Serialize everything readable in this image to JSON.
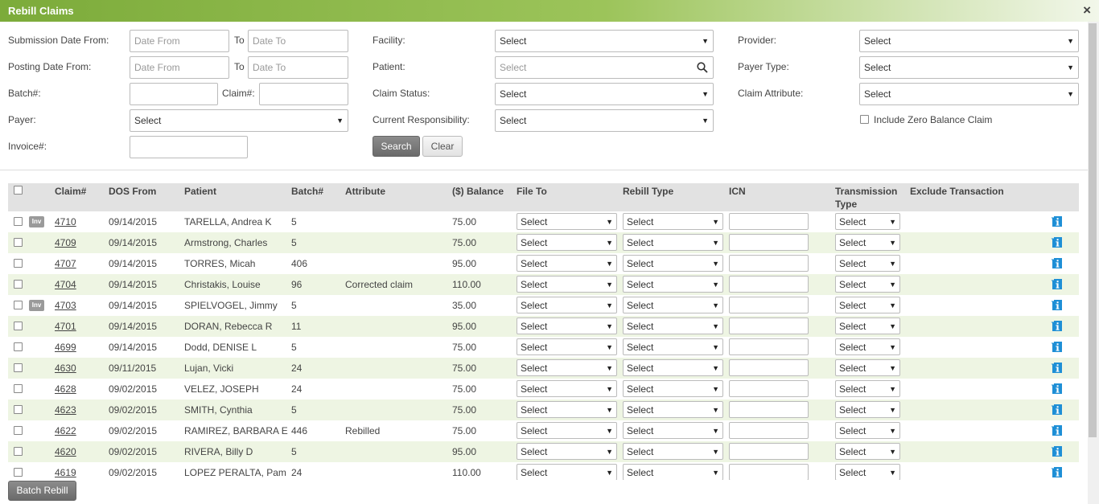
{
  "window": {
    "title": "Rebill Claims",
    "close_glyph": "×"
  },
  "filters": {
    "submission_date_label": "Submission Date From:",
    "posting_date_label": "Posting Date From:",
    "to_label": "To",
    "date_from_placeholder": "Date From",
    "date_to_placeholder": "Date To",
    "batch_label": "Batch#:",
    "claim_label": "Claim#:",
    "payer_label": "Payer:",
    "payer_value": "Select",
    "invoice_label": "Invoice#:",
    "facility_label": "Facility:",
    "facility_value": "Select",
    "patient_label": "Patient:",
    "patient_placeholder": "Select",
    "claim_status_label": "Claim Status:",
    "claim_status_value": "Select",
    "current_responsibility_label": "Current Responsibility:",
    "current_responsibility_value": "Select",
    "provider_label": "Provider:",
    "provider_value": "Select",
    "payer_type_label": "Payer Type:",
    "payer_type_value": "Select",
    "claim_attribute_label": "Claim Attribute:",
    "claim_attribute_value": "Select",
    "include_zero_balance_label": "Include Zero Balance Claim",
    "search_label": "Search",
    "clear_label": "Clear"
  },
  "grid": {
    "columns": [
      "Claim#",
      "DOS From",
      "Patient",
      "Batch#",
      "Attribute",
      "($) Balance",
      "File To",
      "Rebill Type",
      "ICN",
      "Transmission Type",
      "Exclude Transaction"
    ],
    "select_placeholder": "Select",
    "inv_badge": "Inv",
    "rows": [
      {
        "inv": true,
        "claim": "4710",
        "dos": "09/14/2015",
        "patient": "TARELLA, Andrea K",
        "batch": "5",
        "attribute": "",
        "balance": "75.00"
      },
      {
        "inv": false,
        "claim": "4709",
        "dos": "09/14/2015",
        "patient": "Armstrong, Charles",
        "batch": "5",
        "attribute": "",
        "balance": "75.00"
      },
      {
        "inv": false,
        "claim": "4707",
        "dos": "09/14/2015",
        "patient": "TORRES, Micah",
        "batch": "406",
        "attribute": "",
        "balance": "95.00"
      },
      {
        "inv": false,
        "claim": "4704",
        "dos": "09/14/2015",
        "patient": "Christakis, Louise",
        "batch": "96",
        "attribute": "Corrected claim",
        "balance": "110.00"
      },
      {
        "inv": true,
        "claim": "4703",
        "dos": "09/14/2015",
        "patient": "SPIELVOGEL, Jimmy",
        "batch": "5",
        "attribute": "",
        "balance": "35.00"
      },
      {
        "inv": false,
        "claim": "4701",
        "dos": "09/14/2015",
        "patient": "DORAN, Rebecca R",
        "batch": "11",
        "attribute": "",
        "balance": "95.00"
      },
      {
        "inv": false,
        "claim": "4699",
        "dos": "09/14/2015",
        "patient": "Dodd, DENISE L",
        "batch": "5",
        "attribute": "",
        "balance": "75.00"
      },
      {
        "inv": false,
        "claim": "4630",
        "dos": "09/11/2015",
        "patient": "Lujan, Vicki",
        "batch": "24",
        "attribute": "",
        "balance": "75.00"
      },
      {
        "inv": false,
        "claim": "4628",
        "dos": "09/02/2015",
        "patient": "VELEZ, JOSEPH",
        "batch": "24",
        "attribute": "",
        "balance": "75.00"
      },
      {
        "inv": false,
        "claim": "4623",
        "dos": "09/02/2015",
        "patient": "SMITH, Cynthia",
        "batch": "5",
        "attribute": "",
        "balance": "75.00"
      },
      {
        "inv": false,
        "claim": "4622",
        "dos": "09/02/2015",
        "patient": "RAMIREZ, BARBARA E",
        "batch": "446",
        "attribute": "Rebilled",
        "balance": "75.00"
      },
      {
        "inv": false,
        "claim": "4620",
        "dos": "09/02/2015",
        "patient": "RIVERA, Billy D",
        "batch": "5",
        "attribute": "",
        "balance": "95.00"
      },
      {
        "inv": false,
        "claim": "4619",
        "dos": "09/02/2015",
        "patient": "LOPEZ PERALTA, Pam",
        "batch": "24",
        "attribute": "",
        "balance": "110.00"
      }
    ]
  },
  "footer": {
    "batch_rebill_label": "Batch Rebill"
  },
  "colors": {
    "title_bar": "#7cab3a",
    "alt_row": "#eef5e3",
    "info_icon": "#1e8fd6"
  },
  "icons": {
    "close": "close-icon",
    "search": "search-icon",
    "info": "info-icon",
    "dropdown": "chevron-down-icon"
  }
}
